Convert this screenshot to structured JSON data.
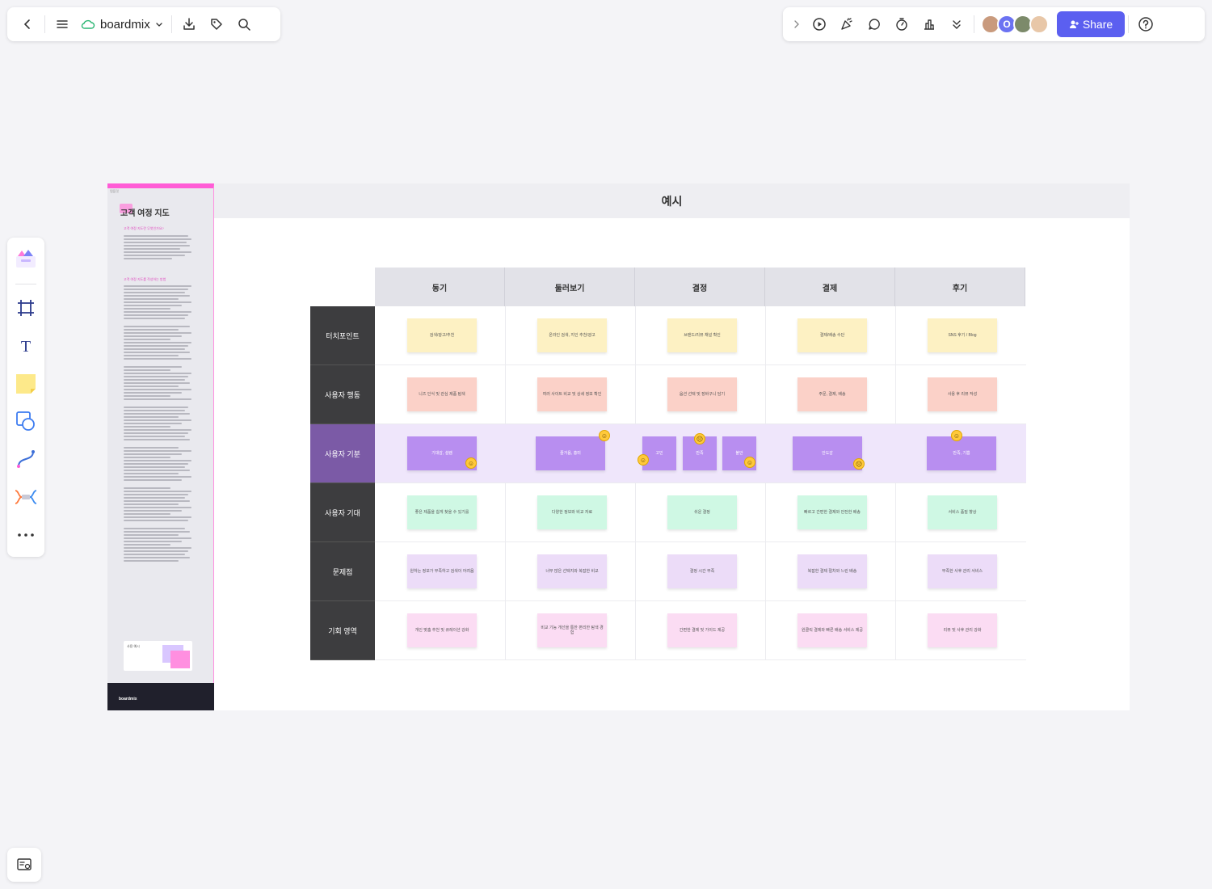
{
  "app": {
    "name": "boardmix"
  },
  "toolbar_right": {
    "share_label": "Share",
    "avatar_initial": "O"
  },
  "board": {
    "title": "예시",
    "columns": [
      "동기",
      "둘러보기",
      "결정",
      "결제",
      "후기"
    ],
    "rows": [
      {
        "label": "터치포인트",
        "color": "#fdf1c3",
        "notes": [
          "검색/광고/추천",
          "온라인 검색, 지인 추천/광고",
          "브랜드/리뷰 채널 확인",
          "결제/배송 수단",
          "SNS 후기 / Blog"
        ]
      },
      {
        "label": "사용자 행동",
        "color": "#fbd1c8",
        "notes": [
          "니즈 인식 및 관심 제품 탐색",
          "여러 사이트 비교 및 상세 정보 확인",
          "옵션 선택 및 장바구니 담기",
          "주문, 결제, 배송",
          "사용 후 리뷰 작성"
        ]
      },
      {
        "label": "사용자 기분",
        "color": "#b88ef0",
        "notes": [
          "기대감, 설렘",
          "즐거움, 흥미",
          "고민",
          "만족",
          "불안",
          "안도감",
          "만족, 기쁨"
        ]
      },
      {
        "label": "사용자 기대",
        "color": "#cff8e4",
        "notes": [
          "좋은 제품을 쉽게 찾을 수 있기를",
          "다양한 정보와 비교 자료",
          "쉬운 결정",
          "빠르고 간편한 결제와 안전한 배송",
          "서비스 품질 향상"
        ]
      },
      {
        "label": "문제점",
        "color": "#ecdcf8",
        "notes": [
          "원하는 정보가 부족하고 검색이 어려움",
          "너무 많은 선택지와 복잡한 비교",
          "결정 시간 부족",
          "복잡한 결제 절차와 느린 배송",
          "부족한 사후 관리 서비스"
        ]
      },
      {
        "label": "기회 영역",
        "color": "#fbdcf3",
        "notes": [
          "개인 맞춤 추천 및 큐레이션 강화",
          "비교 기능 개선을 통한 편리한 탐색 경험",
          "간편한 결제 및 가이드 제공",
          "원클릭 결제와 빠른 배송 서비스 제공",
          "리뷰 및 사후 관리 강화"
        ]
      }
    ]
  },
  "guide": {
    "tag": "템플릿",
    "title": "고객 여정 지도",
    "heading_1": "고객 여정 지도란 무엇인가요?",
    "heading_2": "고객 여정 지도를 작성하는 방법",
    "mini_label": "사용 예시",
    "footer_brand": "boardmix"
  },
  "colors": {
    "accent": "#5b5ff0",
    "guide_pink": "#ff5cd6",
    "row_header": "#3d3d3f",
    "row_header_highlight": "#7b5aa6"
  }
}
